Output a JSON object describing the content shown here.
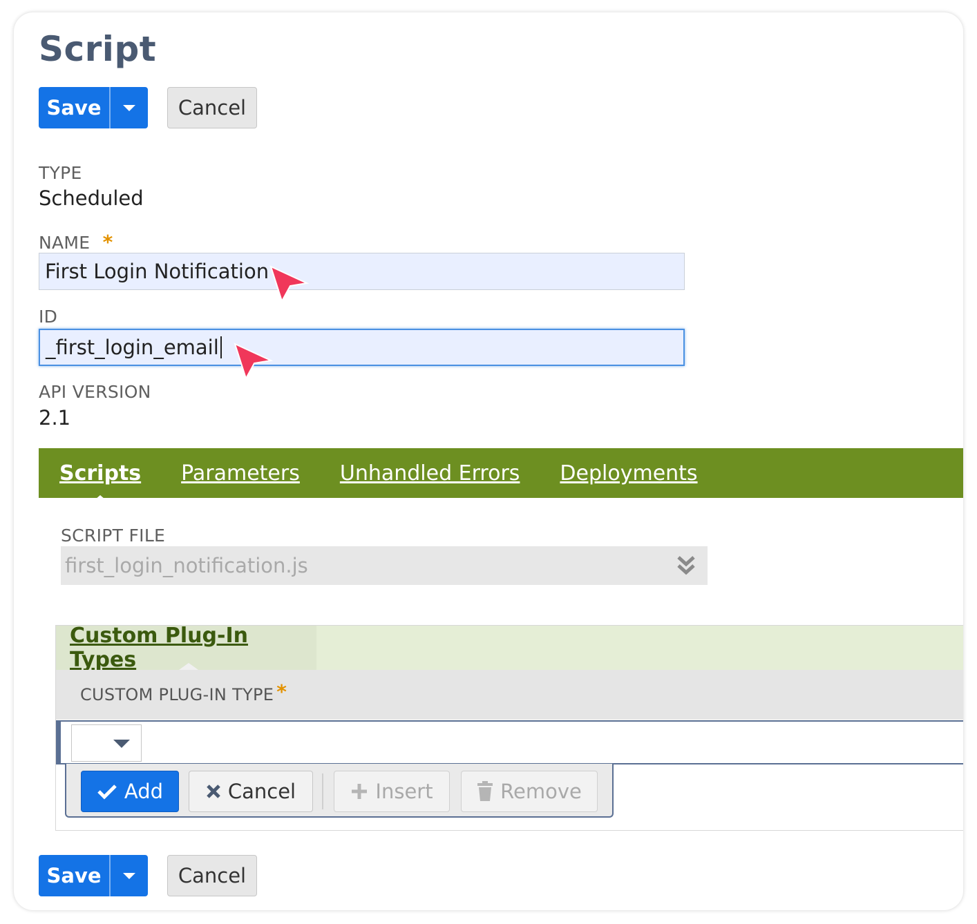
{
  "page": {
    "title": "Script"
  },
  "toolbar": {
    "save_label": "Save",
    "cancel_label": "Cancel"
  },
  "fields": {
    "type_label": "TYPE",
    "type_value": "Scheduled",
    "name_label": "NAME",
    "name_required": "*",
    "name_value": "First Login Notification",
    "id_label": "ID",
    "id_value": "_first_login_email",
    "api_label": "API VERSION",
    "api_value": "2.1"
  },
  "tabs": [
    {
      "label": "Scripts",
      "active": true
    },
    {
      "label": "Parameters",
      "active": false
    },
    {
      "label": "Unhandled Errors",
      "active": false
    },
    {
      "label": "Deployments",
      "active": false
    }
  ],
  "scripts_tab": {
    "file_label": "SCRIPT FILE",
    "file_value": "first_login_notification.js"
  },
  "sublist": {
    "title": "Custom Plug-In Types",
    "column_header": "CUSTOM PLUG-IN TYPE",
    "column_required": "*",
    "buttons": {
      "add": "Add",
      "cancel": "Cancel",
      "insert": "Insert",
      "remove": "Remove"
    }
  },
  "colors": {
    "primary_blue": "#1473e6",
    "tab_green": "#6d8f21",
    "title_slate": "#4a5a72",
    "cursor_pink": "#f0375a"
  },
  "icons": [
    "chevron-down-icon",
    "double-chevron-down-icon",
    "checkmark-icon",
    "x-icon",
    "plus-icon",
    "trash-icon",
    "pointer-cursor-icon"
  ]
}
